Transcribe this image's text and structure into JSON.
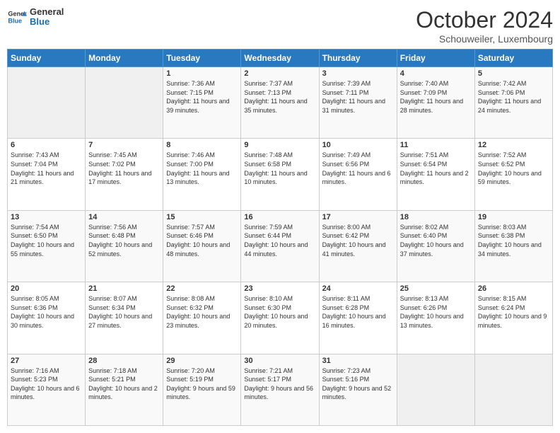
{
  "header": {
    "logo_general": "General",
    "logo_blue": "Blue",
    "month_title": "October 2024",
    "location": "Schouweiler, Luxembourg"
  },
  "weekdays": [
    "Sunday",
    "Monday",
    "Tuesday",
    "Wednesday",
    "Thursday",
    "Friday",
    "Saturday"
  ],
  "weeks": [
    [
      {
        "day": "",
        "info": ""
      },
      {
        "day": "",
        "info": ""
      },
      {
        "day": "1",
        "info": "Sunrise: 7:36 AM\nSunset: 7:15 PM\nDaylight: 11 hours and 39 minutes."
      },
      {
        "day": "2",
        "info": "Sunrise: 7:37 AM\nSunset: 7:13 PM\nDaylight: 11 hours and 35 minutes."
      },
      {
        "day": "3",
        "info": "Sunrise: 7:39 AM\nSunset: 7:11 PM\nDaylight: 11 hours and 31 minutes."
      },
      {
        "day": "4",
        "info": "Sunrise: 7:40 AM\nSunset: 7:09 PM\nDaylight: 11 hours and 28 minutes."
      },
      {
        "day": "5",
        "info": "Sunrise: 7:42 AM\nSunset: 7:06 PM\nDaylight: 11 hours and 24 minutes."
      }
    ],
    [
      {
        "day": "6",
        "info": "Sunrise: 7:43 AM\nSunset: 7:04 PM\nDaylight: 11 hours and 21 minutes."
      },
      {
        "day": "7",
        "info": "Sunrise: 7:45 AM\nSunset: 7:02 PM\nDaylight: 11 hours and 17 minutes."
      },
      {
        "day": "8",
        "info": "Sunrise: 7:46 AM\nSunset: 7:00 PM\nDaylight: 11 hours and 13 minutes."
      },
      {
        "day": "9",
        "info": "Sunrise: 7:48 AM\nSunset: 6:58 PM\nDaylight: 11 hours and 10 minutes."
      },
      {
        "day": "10",
        "info": "Sunrise: 7:49 AM\nSunset: 6:56 PM\nDaylight: 11 hours and 6 minutes."
      },
      {
        "day": "11",
        "info": "Sunrise: 7:51 AM\nSunset: 6:54 PM\nDaylight: 11 hours and 2 minutes."
      },
      {
        "day": "12",
        "info": "Sunrise: 7:52 AM\nSunset: 6:52 PM\nDaylight: 10 hours and 59 minutes."
      }
    ],
    [
      {
        "day": "13",
        "info": "Sunrise: 7:54 AM\nSunset: 6:50 PM\nDaylight: 10 hours and 55 minutes."
      },
      {
        "day": "14",
        "info": "Sunrise: 7:56 AM\nSunset: 6:48 PM\nDaylight: 10 hours and 52 minutes."
      },
      {
        "day": "15",
        "info": "Sunrise: 7:57 AM\nSunset: 6:46 PM\nDaylight: 10 hours and 48 minutes."
      },
      {
        "day": "16",
        "info": "Sunrise: 7:59 AM\nSunset: 6:44 PM\nDaylight: 10 hours and 44 minutes."
      },
      {
        "day": "17",
        "info": "Sunrise: 8:00 AM\nSunset: 6:42 PM\nDaylight: 10 hours and 41 minutes."
      },
      {
        "day": "18",
        "info": "Sunrise: 8:02 AM\nSunset: 6:40 PM\nDaylight: 10 hours and 37 minutes."
      },
      {
        "day": "19",
        "info": "Sunrise: 8:03 AM\nSunset: 6:38 PM\nDaylight: 10 hours and 34 minutes."
      }
    ],
    [
      {
        "day": "20",
        "info": "Sunrise: 8:05 AM\nSunset: 6:36 PM\nDaylight: 10 hours and 30 minutes."
      },
      {
        "day": "21",
        "info": "Sunrise: 8:07 AM\nSunset: 6:34 PM\nDaylight: 10 hours and 27 minutes."
      },
      {
        "day": "22",
        "info": "Sunrise: 8:08 AM\nSunset: 6:32 PM\nDaylight: 10 hours and 23 minutes."
      },
      {
        "day": "23",
        "info": "Sunrise: 8:10 AM\nSunset: 6:30 PM\nDaylight: 10 hours and 20 minutes."
      },
      {
        "day": "24",
        "info": "Sunrise: 8:11 AM\nSunset: 6:28 PM\nDaylight: 10 hours and 16 minutes."
      },
      {
        "day": "25",
        "info": "Sunrise: 8:13 AM\nSunset: 6:26 PM\nDaylight: 10 hours and 13 minutes."
      },
      {
        "day": "26",
        "info": "Sunrise: 8:15 AM\nSunset: 6:24 PM\nDaylight: 10 hours and 9 minutes."
      }
    ],
    [
      {
        "day": "27",
        "info": "Sunrise: 7:16 AM\nSunset: 5:23 PM\nDaylight: 10 hours and 6 minutes."
      },
      {
        "day": "28",
        "info": "Sunrise: 7:18 AM\nSunset: 5:21 PM\nDaylight: 10 hours and 2 minutes."
      },
      {
        "day": "29",
        "info": "Sunrise: 7:20 AM\nSunset: 5:19 PM\nDaylight: 9 hours and 59 minutes."
      },
      {
        "day": "30",
        "info": "Sunrise: 7:21 AM\nSunset: 5:17 PM\nDaylight: 9 hours and 56 minutes."
      },
      {
        "day": "31",
        "info": "Sunrise: 7:23 AM\nSunset: 5:16 PM\nDaylight: 9 hours and 52 minutes."
      },
      {
        "day": "",
        "info": ""
      },
      {
        "day": "",
        "info": ""
      }
    ]
  ]
}
